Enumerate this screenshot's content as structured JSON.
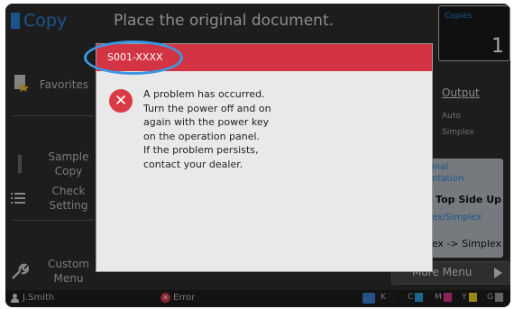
{
  "header": {
    "app_title": "Copy",
    "message": "Place the original document.",
    "copies_label": "Copies",
    "copies_value": "1"
  },
  "left_menu": {
    "favorites": "Favorites",
    "sample_copy_l1": "Sample",
    "sample_copy_l2": "Copy",
    "check_setting_l1": "Check",
    "check_setting_l2": "Setting",
    "custom_menu_l1": "Custom",
    "custom_menu_l2": "Menu"
  },
  "right_panel": {
    "output_title": "Output",
    "output_line1": "Auto",
    "output_line2": "Simplex",
    "orientation_l1": "inal",
    "orientation_l2": "ntation",
    "orientation_value": "Top Side Up",
    "duplex_label": "ex/Simplex",
    "duplex_value": "ex -> Simplex"
  },
  "more_menu": "More Menu",
  "status_bar": {
    "user": "J.Smith",
    "error": "Error",
    "ink_k": "K",
    "ink_c": "C",
    "ink_m": "M",
    "ink_y": "Y",
    "ink_g": "G"
  },
  "dialog": {
    "error_code": "S001-XXXX",
    "lines": [
      "A problem has occurred.",
      "Turn the power off and on",
      "again with the power key",
      "on the operation panel.",
      "If the problem persists,",
      "contact your dealer."
    ]
  },
  "colors": {
    "accent": "#2a82d8",
    "error_red": "#d23444",
    "highlight_ring": "#3a98e6"
  },
  "icons": [
    "copy-icon",
    "star-doc-icon",
    "list-icon",
    "wrench-icon",
    "error-icon",
    "ink-icon",
    "person-icon",
    "arrow-right-icon"
  ]
}
